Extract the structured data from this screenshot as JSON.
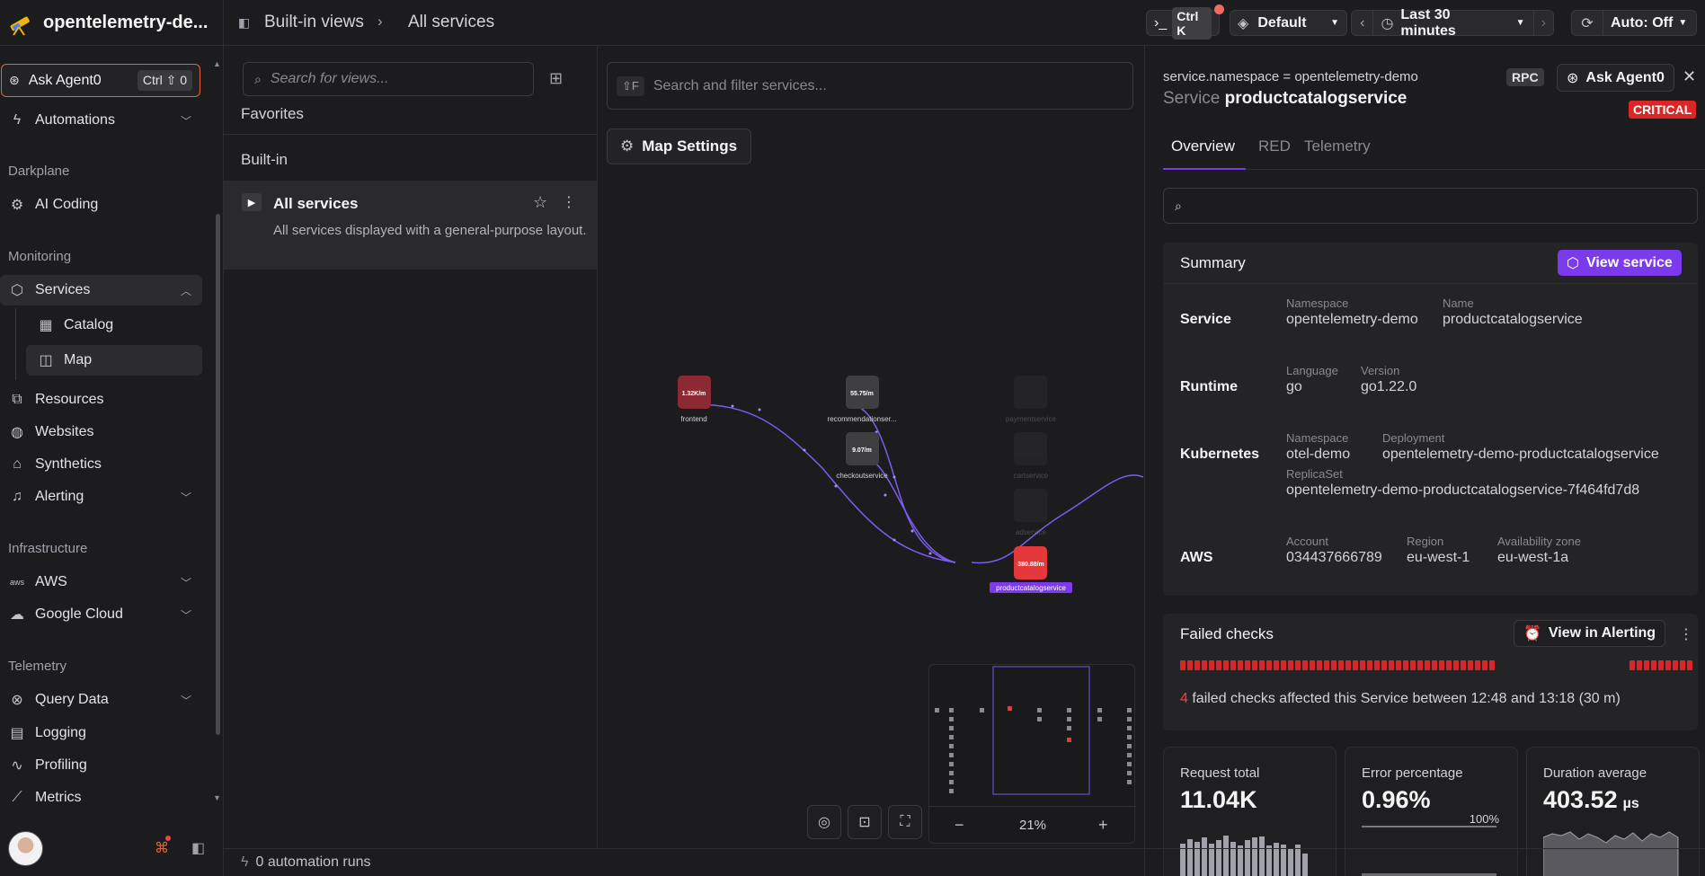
{
  "app": {
    "title": "opentelemetry-de...",
    "ask_agent_label": "Ask Agent0",
    "ask_agent_shortcut": "Ctrl ⇧ 0"
  },
  "sidebar": {
    "automations": "Automations",
    "sections": {
      "darkplane": "Darkplane",
      "monitoring": "Monitoring",
      "infrastructure": "Infrastructure",
      "telemetry": "Telemetry"
    },
    "items": {
      "ai_coding": "AI Coding",
      "services": "Services",
      "catalog": "Catalog",
      "map": "Map",
      "resources": "Resources",
      "websites": "Websites",
      "synthetics": "Synthetics",
      "alerting": "Alerting",
      "aws": "AWS",
      "google_cloud": "Google Cloud",
      "query_data": "Query Data",
      "logging": "Logging",
      "profiling": "Profiling",
      "metrics": "Metrics"
    }
  },
  "topbar": {
    "breadcrumb_1": "Built-in views",
    "breadcrumb_2": "All services",
    "terminal_shortcut": "Ctrl K",
    "profile": "Default",
    "time_range": "Last 30 minutes",
    "auto_refresh": "Auto: Off"
  },
  "views": {
    "search_placeholder": "Search for views...",
    "favorites": "Favorites",
    "builtin": "Built-in",
    "selected_title": "All services",
    "selected_desc": "All services displayed with a general-purpose layout."
  },
  "automation_runs": "0 automation runs",
  "map": {
    "search_shortcut": "⇧F",
    "search_placeholder": "Search and filter services...",
    "settings_label": "Map Settings",
    "zoom": "21%",
    "nodes": {
      "frontend": {
        "rate": "1.32K/m",
        "label": "frontend"
      },
      "recommendation": {
        "rate": "55.75/m",
        "label": "recommendationser..."
      },
      "checkout": {
        "rate": "9.07/m",
        "label": "checkoutservice"
      },
      "productcatalog": {
        "rate": "380.88/m",
        "label": "productcatalogservice"
      },
      "payment": {
        "label": "paymentservice"
      },
      "cart": {
        "label": "cartservice"
      },
      "ad": {
        "label": "adservice"
      }
    }
  },
  "details": {
    "namespace_line": "service.namespace = opentelemetry-demo",
    "kind": "Service",
    "name": "productcatalogservice",
    "rpc_badge": "RPC",
    "ask_agent": "Ask Agent0",
    "severity": "CRITICAL",
    "tabs": [
      "Overview",
      "RED",
      "Telemetry"
    ],
    "summary": {
      "title": "Summary",
      "view_service": "View service",
      "service": {
        "label": "Service",
        "namespace_k": "Namespace",
        "namespace_v": "opentelemetry-demo",
        "name_k": "Name",
        "name_v": "productcatalogservice"
      },
      "runtime": {
        "label": "Runtime",
        "language_k": "Language",
        "language_v": "go",
        "version_k": "Version",
        "version_v": "go1.22.0"
      },
      "kubernetes": {
        "label": "Kubernetes",
        "namespace_k": "Namespace",
        "namespace_v": "otel-demo",
        "deployment_k": "Deployment",
        "deployment_v": "opentelemetry-demo-productcatalogservice",
        "replicaset_k": "ReplicaSet",
        "replicaset_v": "opentelemetry-demo-productcatalogservice-7f464fd7d8"
      },
      "aws": {
        "label": "AWS",
        "account_k": "Account",
        "account_v": "034437666789",
        "region_k": "Region",
        "region_v": "eu-west-1",
        "az_k": "Availability zone",
        "az_v": "eu-west-1a"
      }
    },
    "failed_checks": {
      "title": "Failed checks",
      "view_in_alerting": "View in Alerting",
      "count": "4",
      "text": " failed checks affected this Service between 12:48 and 13:18 (30 m)"
    },
    "metrics": {
      "request_total": {
        "label": "Request total",
        "value": "11.04K"
      },
      "error_percentage": {
        "label": "Error percentage",
        "value": "0.96%",
        "max_label": "100%"
      },
      "duration_average": {
        "label": "Duration average",
        "value": "403.52",
        "unit": "µs"
      }
    }
  },
  "colors": {
    "accent": "#7c3aed",
    "critical": "#dc2626",
    "ask_agent_border": "#e0673a"
  }
}
